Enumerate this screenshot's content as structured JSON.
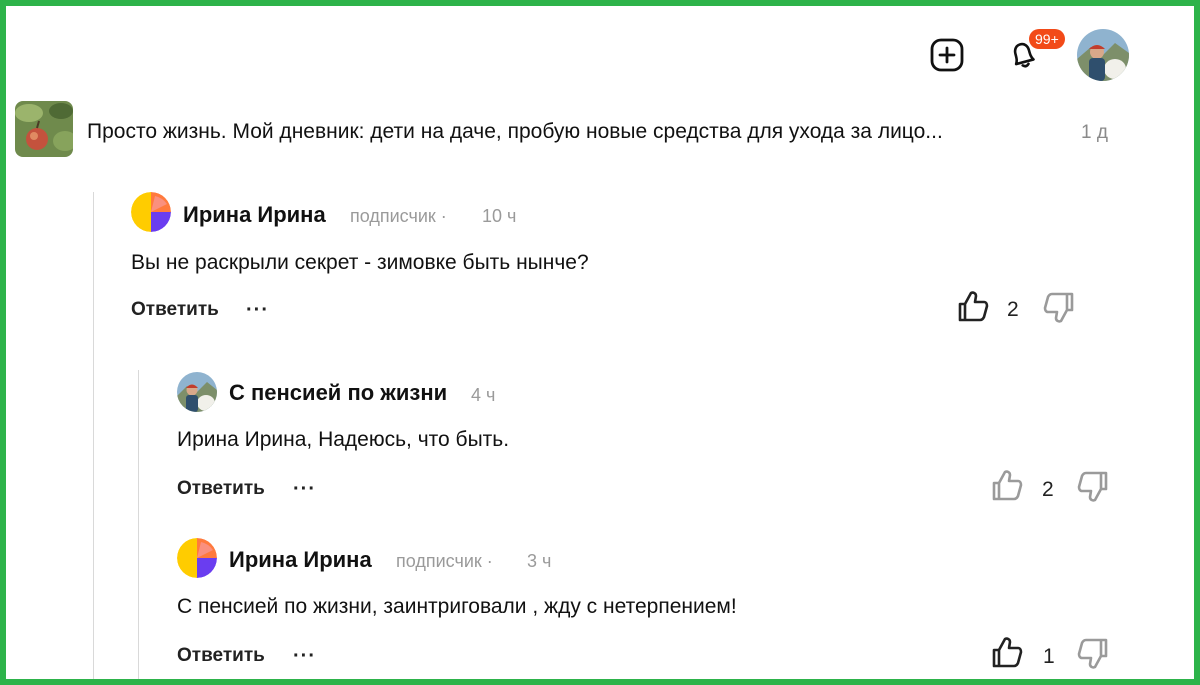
{
  "header": {
    "create_icon": "plus-square-icon",
    "bell_icon": "bell-icon",
    "notification_count": "99+",
    "avatar_icon": "user-avatar"
  },
  "post": {
    "title": "Просто жизнь. Мой дневник: дети на даче, пробую новые средства для ухода за лицо...",
    "time": "1 д"
  },
  "comments": [
    {
      "author": "Ирина Ирина",
      "role": "подписчик ·",
      "time": "10 ч",
      "text": "Вы не раскрыли секрет - зимовке быть нынче?",
      "reply_label": "Ответить",
      "more_label": "···",
      "likes": "2",
      "liked": true
    },
    {
      "author": "С пенсией по жизни",
      "role": "",
      "time": "4 ч",
      "text": "Ирина Ирина, Надеюсь, что быть.",
      "reply_label": "Ответить",
      "more_label": "···",
      "likes": "2",
      "liked": false
    },
    {
      "author": "Ирина Ирина",
      "role": "подписчик ·",
      "time": "3 ч",
      "text": "С пенсией по жизни, заинтриговали , жду с нетерпением!",
      "reply_label": "Ответить",
      "more_label": "···",
      "likes": "1",
      "liked": true
    }
  ],
  "colors": {
    "frame": "#2db34a",
    "badge": "#f24a18",
    "muted_text": "#9a9a9a",
    "icon_dark": "#222222",
    "icon_light": "#9a9a9a",
    "avatar_yellow": "#ffcc00",
    "avatar_purple": "#6a3df0",
    "avatar_orange": "#ff7a3d",
    "avatar_pink": "#f5a3b5"
  }
}
